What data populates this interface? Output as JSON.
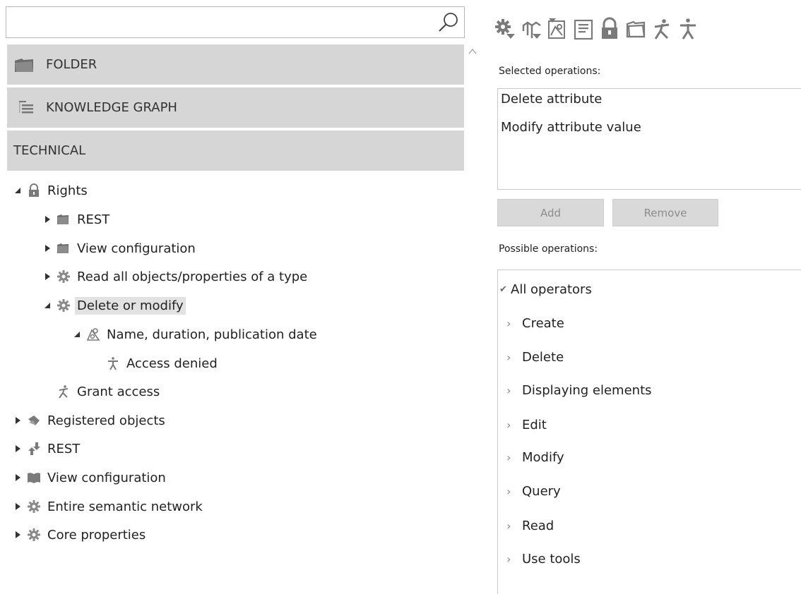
{
  "search": {
    "value": "",
    "placeholder": ""
  },
  "categories": [
    {
      "label": "FOLDER",
      "icon": "folder-icon"
    },
    {
      "label": "KNOWLEDGE GRAPH",
      "icon": "hierarchy-icon"
    },
    {
      "label": "TECHNICAL",
      "icon": ""
    }
  ],
  "tree": {
    "rights": "Rights",
    "rest_folder": "REST",
    "view_config_folder": "View configuration",
    "read_all": "Read all objects/properties of a type",
    "delete_modify": "Delete or modify",
    "name_duration": "Name, duration, publication date",
    "access_denied": "Access denied",
    "grant_access": "Grant access",
    "registered_objects": "Registered objects",
    "rest": "REST",
    "view_configuration": "View configuration",
    "entire_semantic": "Entire semantic network",
    "core_properties": "Core properties"
  },
  "right": {
    "selected_title": "Selected operations:",
    "selected": [
      "Delete attribute",
      "Modify attribute value"
    ],
    "add_label": "Add",
    "remove_label": "Remove",
    "possible_title": "Possible operations:",
    "possible_all": "All operators",
    "possible": [
      "Create",
      "Delete",
      "Displaying elements",
      "Edit",
      "Modify",
      "Query",
      "Read",
      "Use tools"
    ]
  },
  "colors": {
    "category_bg": "#d6d6d6",
    "icon_gray": "#7a7a7a",
    "selected_bg": "#e2e2e2",
    "button_bg": "#d9d9d9"
  }
}
